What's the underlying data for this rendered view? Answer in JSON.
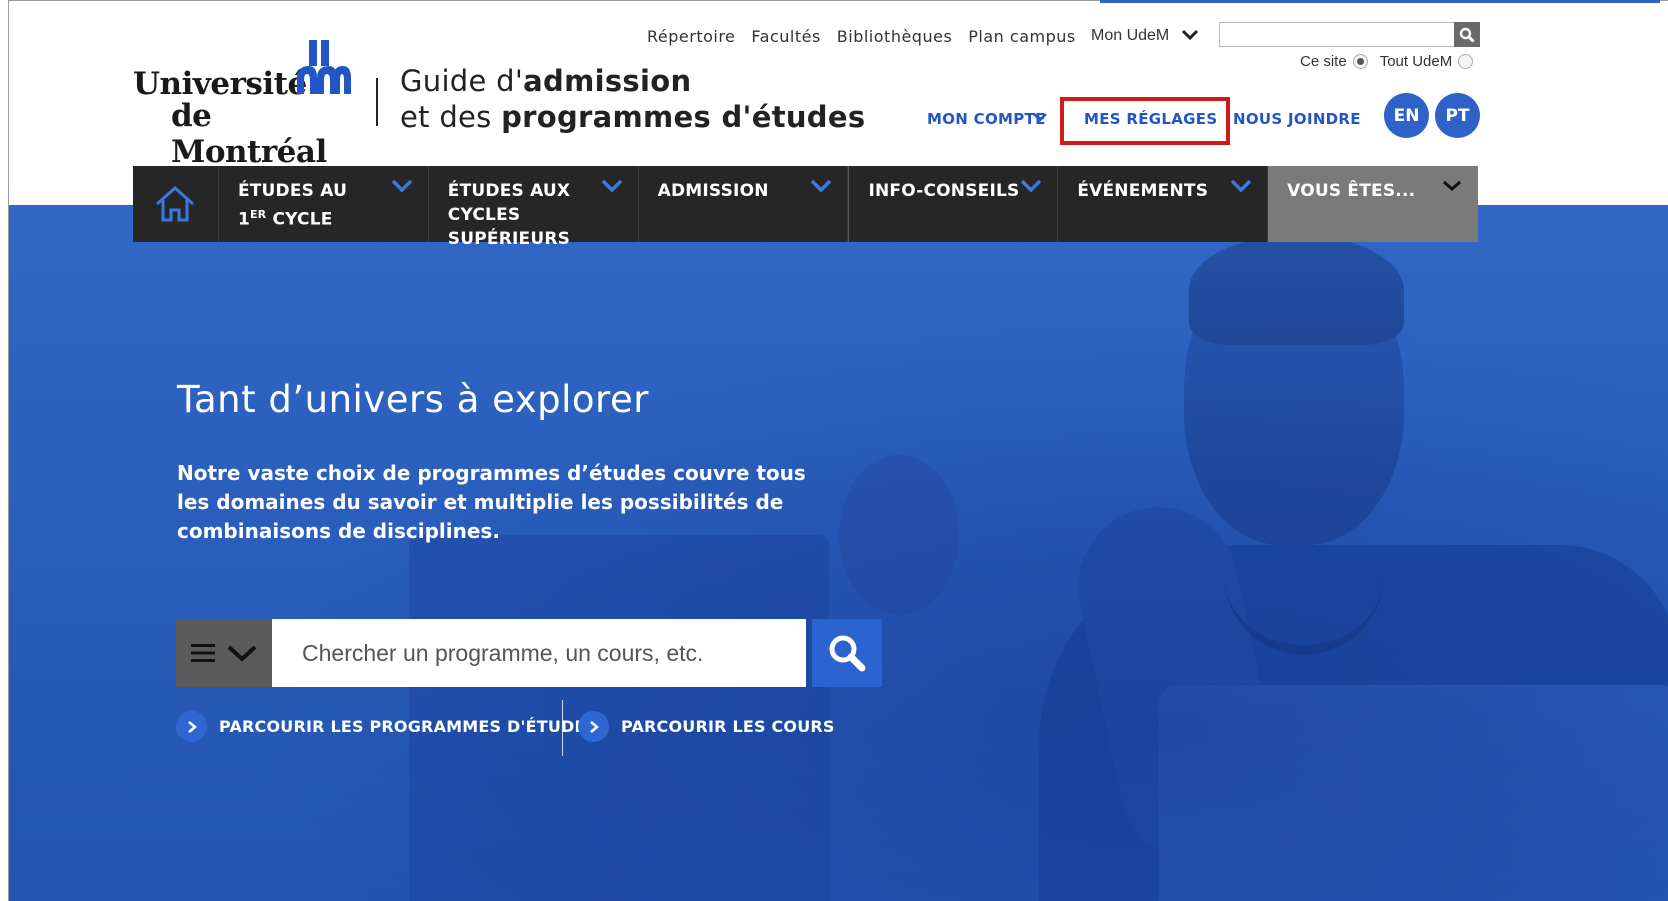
{
  "brand": {
    "line1": "Université",
    "line2": "de Montréal"
  },
  "site_title": {
    "line1_pre": "Guide d'",
    "line1_bold": "admission",
    "line2_pre": "et des ",
    "line2_bold": "programmes d'études"
  },
  "top_links": [
    "Répertoire",
    "Facultés",
    "Bibliothèques",
    "Plan campus"
  ],
  "mon_udem": "Mon UdeM",
  "top_search": {
    "value": "",
    "scope_options": [
      "Ce site",
      "Tout UdeM"
    ],
    "selected_scope": "Ce site"
  },
  "account_links": {
    "mon_compte": "MON COMPTE",
    "mes_reglages": "MES RÉGLAGES",
    "nous_joindre": "NOUS JOINDRE"
  },
  "languages": [
    "EN",
    "PT"
  ],
  "nav": {
    "items": [
      {
        "line1": "ÉTUDES AU",
        "line2_num": "1",
        "line2_sup": "ER",
        "line2_rest": " CYCLE"
      },
      {
        "line1": "ÉTUDES AUX",
        "line2": "CYCLES SUPÉRIEURS"
      },
      {
        "line1": "ADMISSION"
      },
      {
        "line1": "INFO-CONSEILS"
      },
      {
        "line1": "ÉVÉNEMENTS"
      },
      {
        "line1": "VOUS ÊTES..."
      }
    ]
  },
  "hero": {
    "tagline": "Tant d’univers à explorer",
    "description": "Notre vaste choix de programmes d’études couvre tous les domaines du savoir et multiplie les possibilités de combinaisons de disciplines.",
    "search_placeholder": "Chercher un programme, un cours, etc.",
    "browse_programs": "PARCOURIR LES PROGRAMMES D'ÉTUDES",
    "browse_courses": "PARCOURIR LES COURS"
  },
  "colors": {
    "accent_blue": "#2356c5",
    "nav_bg": "#262626",
    "highlight_red": "#d11919",
    "hero_blue": "#2b5fbe"
  }
}
